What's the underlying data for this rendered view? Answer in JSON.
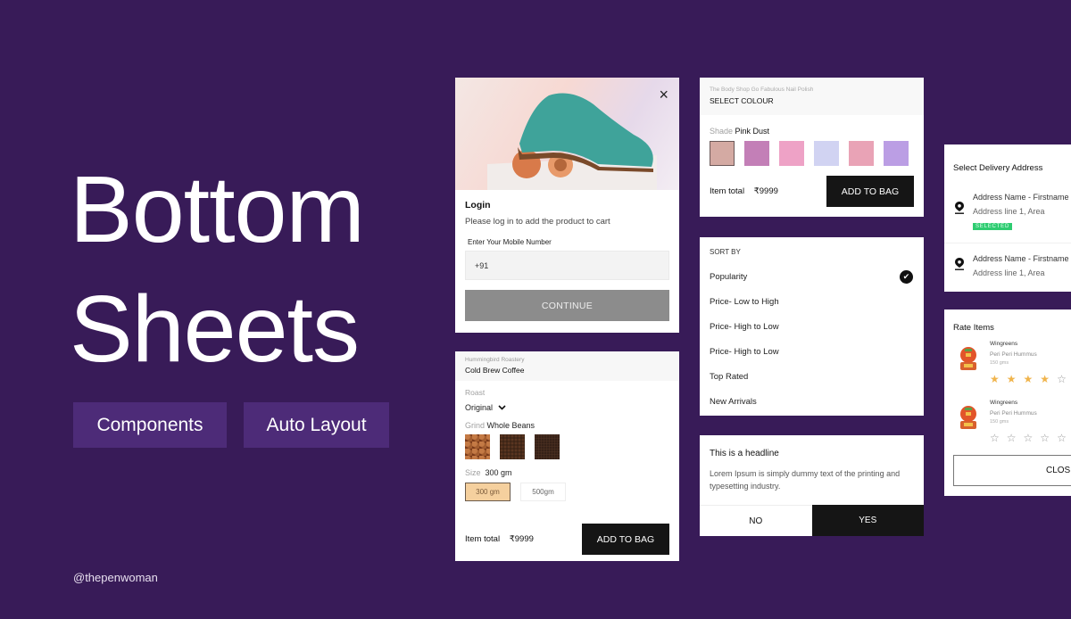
{
  "hero": {
    "title_line1": "Bottom",
    "title_line2": "Sheets",
    "tags": [
      "Components",
      "Auto Layout"
    ],
    "handle": "@thepenwoman"
  },
  "login": {
    "image_alt": "teal suede brogue shoe on peaches",
    "close_icon": "×",
    "title": "Login",
    "subtitle": "Please log in to add the product to cart",
    "mobile_label": "Enter Your Mobile Number",
    "mobile_value": "+91",
    "continue_label": "CONTINUE"
  },
  "coffee": {
    "brand": "Hummingbird Roastery",
    "name": "Cold Brew Coffee",
    "roast_label": "Roast",
    "roast_value": "Original",
    "grind_label": "Grind",
    "grind_value": "Whole Beans",
    "grind_options": [
      "whole-beans",
      "medium-ground",
      "fine-ground"
    ],
    "size_label": "Size",
    "size_value": "300 gm",
    "size_options": [
      "300 gm",
      "500gm"
    ],
    "selected_size": "300 gm",
    "item_total_label": "Item total",
    "item_total_value": "₹9999",
    "add_to_bag": "ADD TO BAG"
  },
  "colour": {
    "brand": "The Body Shop Go Fabulous Nail Polish",
    "title": "SELECT COLOUR",
    "shade_label": "Shade",
    "shade_value": "Pink Dust",
    "swatches": [
      "#d4aaa3",
      "#c37fb7",
      "#eea2c6",
      "#d1d3f2",
      "#e9a3b6",
      "#bb9ee4"
    ],
    "selected_index": 0,
    "item_total_label": "Item total",
    "item_total_value": "₹9999",
    "add_to_bag": "ADD TO BAG"
  },
  "sort": {
    "header": "SORT BY",
    "options": [
      "Popularity",
      "Price- Low to High",
      "Price- High to Low",
      "Price- High to Low",
      "Top Rated",
      "New Arrivals"
    ],
    "selected": "Popularity"
  },
  "dialog": {
    "headline": "This is a headline",
    "body": "Lorem Ipsum is simply dummy text of the printing and typesetting industry.",
    "no_label": "NO",
    "yes_label": "YES"
  },
  "address": {
    "title": "Select Delivery Address",
    "items": [
      {
        "name": "Address Name - Firstname",
        "line": "Address line 1, Area",
        "badge": "SELECTED"
      },
      {
        "name": "Address Name - Firstname",
        "line": "Address line 1, Area"
      }
    ]
  },
  "rate": {
    "title": "Rate Items",
    "items": [
      {
        "brand": "Wingreens",
        "product": "Peri Peri Hummus",
        "weight": "150 gms",
        "rating": 4,
        "max": 5
      },
      {
        "brand": "Wingreens",
        "product": "Peri Peri Hummus",
        "weight": "150 gms",
        "rating": 0,
        "max": 5
      }
    ],
    "close_label": "CLOSE"
  },
  "colors": {
    "background": "#381b58",
    "tag_bg": "#4d2b78",
    "primary_button": "#151515",
    "disabled_button": "#8c8c8c",
    "selected_badge": "#2ecc71",
    "star_on": "#f0b44c"
  }
}
